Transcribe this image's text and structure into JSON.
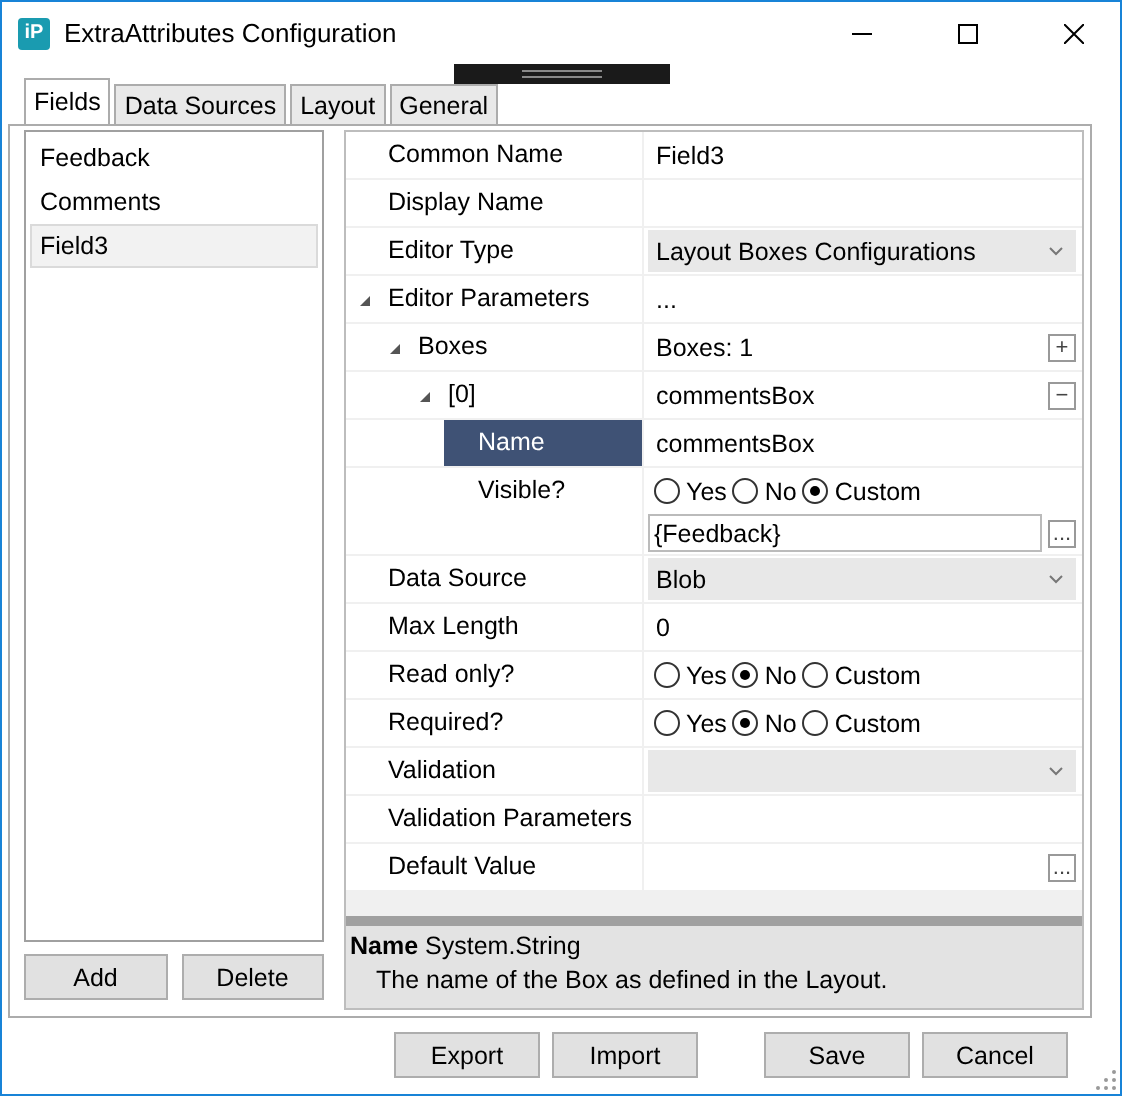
{
  "window": {
    "title": "ExtraAttributes Configuration",
    "logo": "iP"
  },
  "tabs": [
    {
      "label": "Fields",
      "selected": true
    },
    {
      "label": "Data Sources",
      "selected": false
    },
    {
      "label": "Layout",
      "selected": false
    },
    {
      "label": "General",
      "selected": false
    }
  ],
  "fields": [
    {
      "label": "Feedback",
      "selected": false
    },
    {
      "label": "Comments",
      "selected": false
    },
    {
      "label": "Field3",
      "selected": true
    }
  ],
  "field_buttons": [
    "Add",
    "Delete"
  ],
  "properties": [
    {
      "kind": "text",
      "label": "Common Name",
      "value": "Field3",
      "selected": false
    },
    {
      "kind": "text",
      "label": "Display Name",
      "selected": false
    },
    {
      "kind": "dropdown",
      "label": "Editor Type",
      "value": "Layout Boxes Configurations",
      "selected": false
    },
    {
      "kind": "group",
      "label": "Editor Parameters",
      "value": "...",
      "expanded": true,
      "selected": false,
      "children": [
        {
          "kind": "collection",
          "label": "Boxes",
          "value": "Boxes: 1",
          "button": "+",
          "expanded": true,
          "selected": false,
          "children": [
            {
              "kind": "collection",
              "label": "[0]",
              "value": "commentsBox",
              "button": "−",
              "expanded": true,
              "selected": false,
              "children": [
                {
                  "kind": "text",
                  "label": "Name",
                  "value": "commentsBox",
                  "selected": true
                },
                {
                  "kind": "radio",
                  "label": "Visible?",
                  "selected": false,
                  "options": [
                    {
                      "label": "Yes",
                      "selected": false
                    },
                    {
                      "label": "No",
                      "selected": false
                    },
                    {
                      "label": "Custom",
                      "selected": true
                    }
                  ],
                  "expression": "{Feedback}",
                  "browse": "..."
                }
              ]
            }
          ]
        }
      ]
    },
    {
      "kind": "dropdown",
      "label": "Data Source",
      "value": "Blob",
      "selected": false
    },
    {
      "kind": "text",
      "label": "Max Length",
      "value": "0",
      "selected": false
    },
    {
      "kind": "radio",
      "label": "Read only?",
      "selected": false,
      "options": [
        {
          "label": "Yes",
          "selected": false
        },
        {
          "label": "No",
          "selected": true
        },
        {
          "label": "Custom",
          "selected": false
        }
      ]
    },
    {
      "kind": "radio",
      "label": "Required?",
      "selected": false,
      "options": [
        {
          "label": "Yes",
          "selected": false
        },
        {
          "label": "No",
          "selected": true
        },
        {
          "label": "Custom",
          "selected": false
        }
      ]
    },
    {
      "kind": "dropdown",
      "label": "Validation",
      "selected": false
    },
    {
      "kind": "text",
      "label": "Validation Parameters",
      "selected": false
    },
    {
      "kind": "text",
      "label": "Default Value",
      "browse": "...",
      "selected": false
    }
  ],
  "description": {
    "title": "**Name** System.String",
    "text": "The name of the Box as defined in the Layout."
  },
  "dialog_buttons": [
    "Export",
    "Import",
    "Save",
    "Cancel"
  ]
}
